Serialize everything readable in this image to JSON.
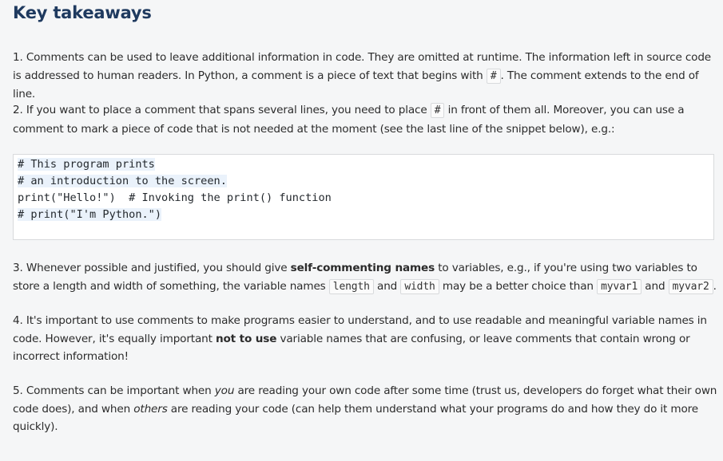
{
  "title": "Key takeaways",
  "p1": {
    "num": "1. ",
    "a": "Comments can be used to leave additional information in code. They are omitted at runtime. The information left in source code is addressed to human readers. In Python, a comment is a piece of text that begins with ",
    "code": "#",
    "b": ". The comment extends to the end of line."
  },
  "p2": {
    "num": "2. ",
    "a": "If you want to place a comment that spans several lines, you need to place ",
    "code": "#",
    "b": " in front of them all. Moreover, you can use a comment to mark a piece of code that is not needed at the moment (see the last line of the snippet below), e.g.:"
  },
  "code_lines": [
    "# This program prints",
    "# an introduction to the screen.",
    "print(\"Hello!\")  # Invoking the print() function",
    "# print(\"I'm Python.\")"
  ],
  "p3": {
    "num": "3. ",
    "a": "Whenever possible and justified, you should give ",
    "bold": "self-commenting names",
    "b": " to variables, e.g., if you're using two variables to store a length and width of something, the variable names ",
    "code1": "length",
    "c": " and ",
    "code2": "width",
    "d": " may be a better choice than ",
    "code3": "myvar1",
    "e": " and ",
    "code4": "myvar2",
    "f": "."
  },
  "p4": {
    "num": "4. ",
    "a": "It's important to use comments to make programs easier to understand, and to use readable and meaningful variable names in code. However, it's equally important ",
    "bold": "not to use",
    "b": " variable names that are confusing, or leave comments that contain wrong or incorrect information!"
  },
  "p5": {
    "num": "5. ",
    "a": "Comments can be important when ",
    "em1": "you",
    "b": " are reading your own code after some time (trust us, developers do forget what their own code does), and when ",
    "em2": "others",
    "c": " are reading your code (can help them understand what your programs do and how they do it more quickly)."
  }
}
